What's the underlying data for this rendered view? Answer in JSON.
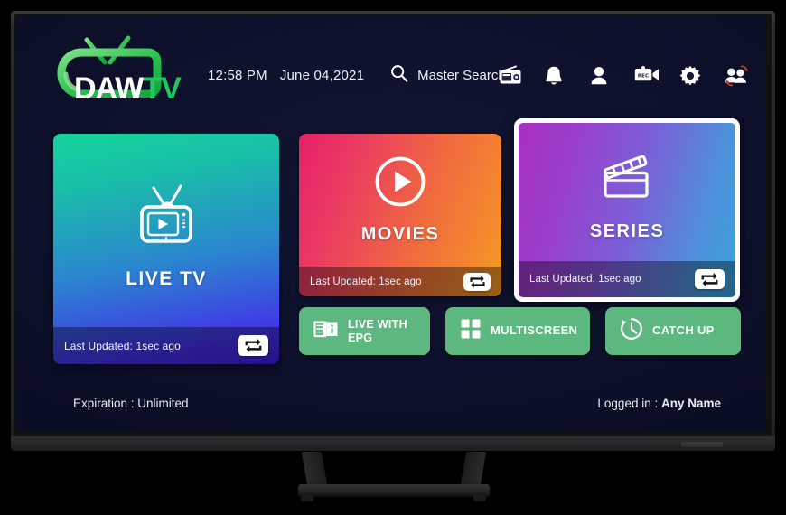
{
  "app": {
    "logo": {
      "part1": "DAW",
      "part2": "TV",
      "icon": "tv-logo-icon"
    },
    "header": {
      "time": "12:58 PM",
      "date": "June 04,2021",
      "search_icon": "search-icon",
      "search_label": "Master Search",
      "icons": [
        {
          "name": "radio-icon",
          "label": "Radio"
        },
        {
          "name": "bell-icon",
          "label": "Notifications"
        },
        {
          "name": "account-icon",
          "label": "Account"
        },
        {
          "name": "rec-camera-icon",
          "label": "Recordings"
        },
        {
          "name": "gear-icon",
          "label": "Settings"
        },
        {
          "name": "switch-user-icon",
          "label": "Switch User"
        }
      ]
    },
    "cards": [
      {
        "id": "live-tv",
        "title": "LIVE TV",
        "icon": "tv-antenna-play-icon",
        "updated": "Last Updated: 1sec ago",
        "refresh_icon": "refresh-loop-icon",
        "focused": false
      },
      {
        "id": "movies",
        "title": "MOVIES",
        "icon": "play-circle-icon",
        "updated": "Last Updated: 1sec ago",
        "refresh_icon": "refresh-loop-icon",
        "focused": false
      },
      {
        "id": "series",
        "title": "SERIES",
        "icon": "clapperboard-icon",
        "updated": "Last Updated: 1sec ago",
        "refresh_icon": "refresh-loop-icon",
        "focused": true
      }
    ],
    "actions": [
      {
        "id": "live-with-epg",
        "line1": "LIVE WITH",
        "line2": "EPG",
        "icon": "book-info-icon"
      },
      {
        "id": "multiscreen",
        "line1": "MULTISCREEN",
        "line2": "",
        "icon": "grid-four-icon"
      },
      {
        "id": "catch-up",
        "line1": "CATCH UP",
        "line2": "",
        "icon": "clock-rewind-icon"
      }
    ],
    "footer": {
      "expiration": "Expiration : Unlimited",
      "logged_in_label": "Logged in : ",
      "logged_in_user": "Any Name"
    },
    "colors": {
      "screen_bg": "#0a0e21",
      "logo_green": "#22c55e",
      "action_green": "#5cb87f",
      "focus_border": "#ffffff",
      "live_gradient_from": "#14d49a",
      "live_gradient_to": "#3a1fe0",
      "movies_gradient_from": "#e81f6b",
      "movies_gradient_to": "#f59a24",
      "series_gradient_from": "#a92fc2",
      "series_gradient_to": "#3aa3dd"
    }
  }
}
